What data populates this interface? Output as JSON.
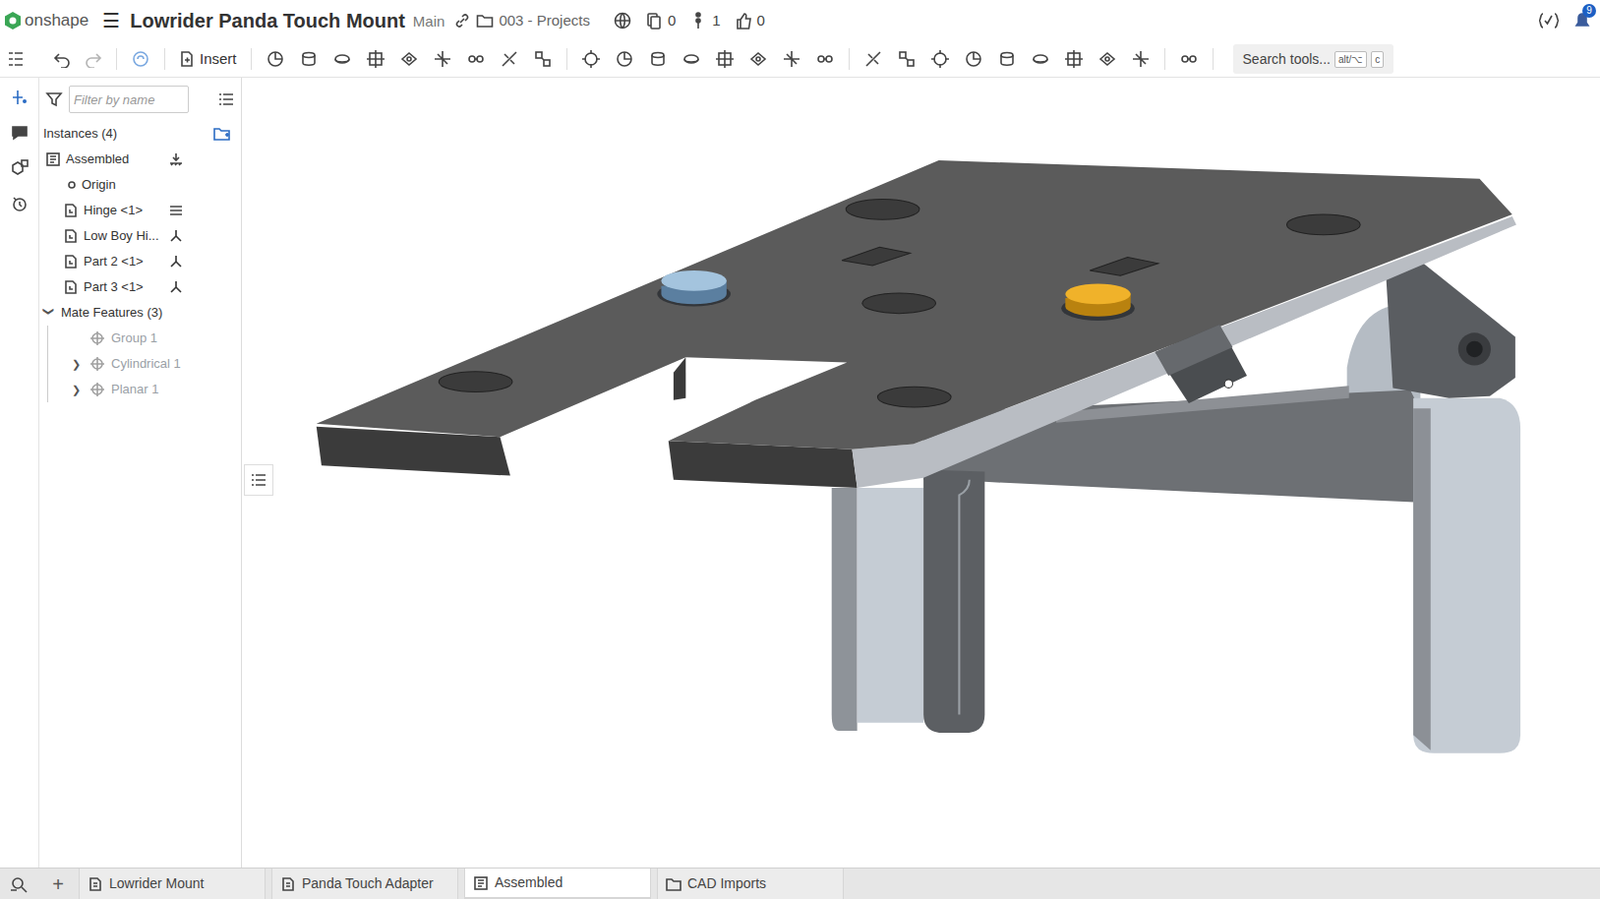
{
  "app": {
    "logo": "onshape",
    "menu": "☰"
  },
  "document": {
    "title": "Lowrider Panda Touch Mount",
    "branch": "Main",
    "folder": "003 - Projects",
    "counts": [
      {
        "kind": "copies",
        "value": "0"
      },
      {
        "kind": "versions",
        "value": "1"
      },
      {
        "kind": "likes",
        "value": "0"
      }
    ]
  },
  "notifications": {
    "badge": "9"
  },
  "toolbar": {
    "insert": "Insert",
    "search": "Search tools...",
    "shortcut": [
      "alt/⌥",
      "c"
    ]
  },
  "feature_panel": {
    "filter_placeholder": "Filter by name",
    "instances_header": "Instances (4)",
    "instances": [
      {
        "label": "Assembled",
        "kind": "assembly"
      },
      {
        "label": "Origin",
        "kind": "origin"
      },
      {
        "label": "Hinge <1>",
        "kind": "fixed"
      },
      {
        "label": "Low Boy Hi...",
        "kind": "free"
      },
      {
        "label": "Part 2 <1>",
        "kind": "free"
      },
      {
        "label": "Part 3 <1>",
        "kind": "free"
      }
    ],
    "mates_header": "Mate Features (3)",
    "mates_expanded": true,
    "mates": [
      {
        "label": "Group 1",
        "expandable": false,
        "dimmed": true
      },
      {
        "label": "Cylindrical 1",
        "expandable": true,
        "dimmed": true
      },
      {
        "label": "Planar 1",
        "expandable": true,
        "dimmed": true
      }
    ]
  },
  "tabs": [
    {
      "label": "Lowrider Mount",
      "kind": "partstudio",
      "selected": false
    },
    {
      "label": "Panda Touch Adapter",
      "kind": "partstudio",
      "selected": false
    },
    {
      "label": "Assembled",
      "kind": "assembly",
      "selected": true
    },
    {
      "label": "CAD Imports",
      "kind": "folder",
      "selected": false
    }
  ],
  "add_tab": "+"
}
